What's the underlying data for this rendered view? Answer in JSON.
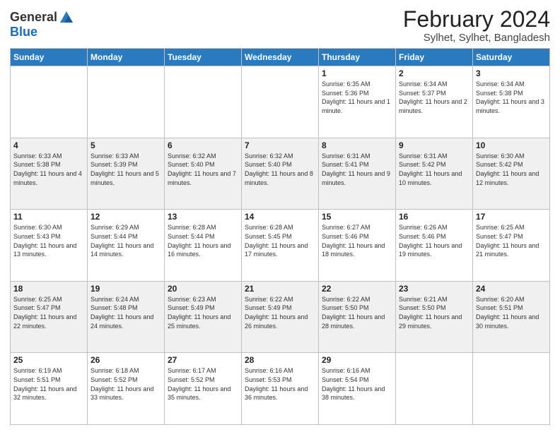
{
  "header": {
    "logo_general": "General",
    "logo_blue": "Blue",
    "title": "February 2024",
    "subtitle": "Sylhet, Sylhet, Bangladesh"
  },
  "columns": [
    "Sunday",
    "Monday",
    "Tuesday",
    "Wednesday",
    "Thursday",
    "Friday",
    "Saturday"
  ],
  "rows": [
    [
      {
        "day": "",
        "info": ""
      },
      {
        "day": "",
        "info": ""
      },
      {
        "day": "",
        "info": ""
      },
      {
        "day": "",
        "info": ""
      },
      {
        "day": "1",
        "info": "Sunrise: 6:35 AM\nSunset: 5:36 PM\nDaylight: 11 hours and 1 minute."
      },
      {
        "day": "2",
        "info": "Sunrise: 6:34 AM\nSunset: 5:37 PM\nDaylight: 11 hours and 2 minutes."
      },
      {
        "day": "3",
        "info": "Sunrise: 6:34 AM\nSunset: 5:38 PM\nDaylight: 11 hours and 3 minutes."
      }
    ],
    [
      {
        "day": "4",
        "info": "Sunrise: 6:33 AM\nSunset: 5:38 PM\nDaylight: 11 hours and 4 minutes."
      },
      {
        "day": "5",
        "info": "Sunrise: 6:33 AM\nSunset: 5:39 PM\nDaylight: 11 hours and 5 minutes."
      },
      {
        "day": "6",
        "info": "Sunrise: 6:32 AM\nSunset: 5:40 PM\nDaylight: 11 hours and 7 minutes."
      },
      {
        "day": "7",
        "info": "Sunrise: 6:32 AM\nSunset: 5:40 PM\nDaylight: 11 hours and 8 minutes."
      },
      {
        "day": "8",
        "info": "Sunrise: 6:31 AM\nSunset: 5:41 PM\nDaylight: 11 hours and 9 minutes."
      },
      {
        "day": "9",
        "info": "Sunrise: 6:31 AM\nSunset: 5:42 PM\nDaylight: 11 hours and 10 minutes."
      },
      {
        "day": "10",
        "info": "Sunrise: 6:30 AM\nSunset: 5:42 PM\nDaylight: 11 hours and 12 minutes."
      }
    ],
    [
      {
        "day": "11",
        "info": "Sunrise: 6:30 AM\nSunset: 5:43 PM\nDaylight: 11 hours and 13 minutes."
      },
      {
        "day": "12",
        "info": "Sunrise: 6:29 AM\nSunset: 5:44 PM\nDaylight: 11 hours and 14 minutes."
      },
      {
        "day": "13",
        "info": "Sunrise: 6:28 AM\nSunset: 5:44 PM\nDaylight: 11 hours and 16 minutes."
      },
      {
        "day": "14",
        "info": "Sunrise: 6:28 AM\nSunset: 5:45 PM\nDaylight: 11 hours and 17 minutes."
      },
      {
        "day": "15",
        "info": "Sunrise: 6:27 AM\nSunset: 5:46 PM\nDaylight: 11 hours and 18 minutes."
      },
      {
        "day": "16",
        "info": "Sunrise: 6:26 AM\nSunset: 5:46 PM\nDaylight: 11 hours and 19 minutes."
      },
      {
        "day": "17",
        "info": "Sunrise: 6:25 AM\nSunset: 5:47 PM\nDaylight: 11 hours and 21 minutes."
      }
    ],
    [
      {
        "day": "18",
        "info": "Sunrise: 6:25 AM\nSunset: 5:47 PM\nDaylight: 11 hours and 22 minutes."
      },
      {
        "day": "19",
        "info": "Sunrise: 6:24 AM\nSunset: 5:48 PM\nDaylight: 11 hours and 24 minutes."
      },
      {
        "day": "20",
        "info": "Sunrise: 6:23 AM\nSunset: 5:49 PM\nDaylight: 11 hours and 25 minutes."
      },
      {
        "day": "21",
        "info": "Sunrise: 6:22 AM\nSunset: 5:49 PM\nDaylight: 11 hours and 26 minutes."
      },
      {
        "day": "22",
        "info": "Sunrise: 6:22 AM\nSunset: 5:50 PM\nDaylight: 11 hours and 28 minutes."
      },
      {
        "day": "23",
        "info": "Sunrise: 6:21 AM\nSunset: 5:50 PM\nDaylight: 11 hours and 29 minutes."
      },
      {
        "day": "24",
        "info": "Sunrise: 6:20 AM\nSunset: 5:51 PM\nDaylight: 11 hours and 30 minutes."
      }
    ],
    [
      {
        "day": "25",
        "info": "Sunrise: 6:19 AM\nSunset: 5:51 PM\nDaylight: 11 hours and 32 minutes."
      },
      {
        "day": "26",
        "info": "Sunrise: 6:18 AM\nSunset: 5:52 PM\nDaylight: 11 hours and 33 minutes."
      },
      {
        "day": "27",
        "info": "Sunrise: 6:17 AM\nSunset: 5:52 PM\nDaylight: 11 hours and 35 minutes."
      },
      {
        "day": "28",
        "info": "Sunrise: 6:16 AM\nSunset: 5:53 PM\nDaylight: 11 hours and 36 minutes."
      },
      {
        "day": "29",
        "info": "Sunrise: 6:16 AM\nSunset: 5:54 PM\nDaylight: 11 hours and 38 minutes."
      },
      {
        "day": "",
        "info": ""
      },
      {
        "day": "",
        "info": ""
      }
    ]
  ],
  "row_styles": [
    "white",
    "gray",
    "white",
    "gray",
    "white"
  ]
}
